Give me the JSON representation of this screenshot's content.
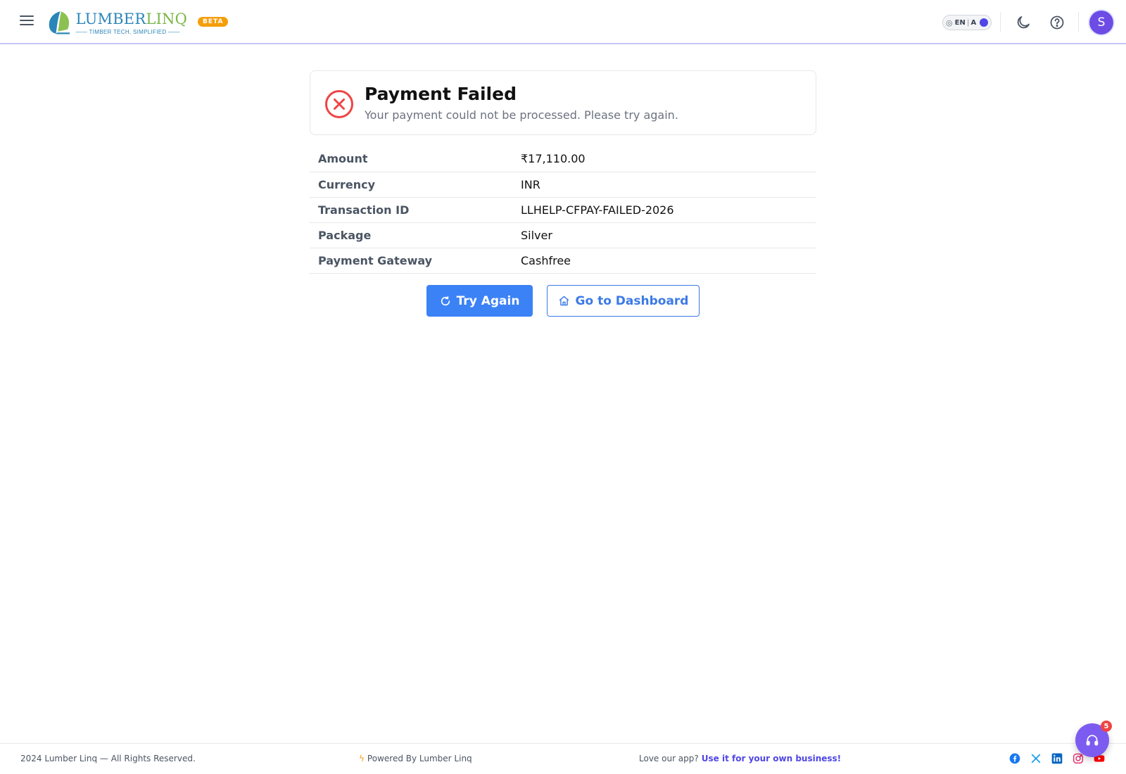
{
  "header": {
    "brand_lumber": "LUMBER",
    "brand_linq": "LINQ",
    "brand_tagline": "—— TIMBER TECH, SIMPLIFIED ——",
    "beta_label": "BETA",
    "lang_primary": "EN",
    "lang_secondary": "A",
    "avatar_initial": "S"
  },
  "alert": {
    "title": "Payment Failed",
    "message": "Your payment could not be processed. Please try again.",
    "status_color": "#ef4444"
  },
  "details": [
    {
      "label": "Amount",
      "value": "₹17,110.00"
    },
    {
      "label": "Currency",
      "value": "INR"
    },
    {
      "label": "Transaction ID",
      "value": "LLHELP-CFPAY-FAILED-2026"
    },
    {
      "label": "Package",
      "value": "Silver"
    },
    {
      "label": "Payment Gateway",
      "value": "Cashfree"
    }
  ],
  "actions": {
    "try_again": "Try Again",
    "dashboard": "Go to Dashboard"
  },
  "footer": {
    "copyright": "2024 Lumber Linq — All Rights Reserved.",
    "powered": "Powered By Lumber Linq",
    "love_text": "Love our app?",
    "love_link": "Use it for your own business!"
  },
  "support": {
    "badge_count": "5"
  },
  "colors": {
    "primary": "#3b82f6",
    "accent": "#4f46e5",
    "danger": "#ef4444",
    "beta": "#f59e0b"
  }
}
